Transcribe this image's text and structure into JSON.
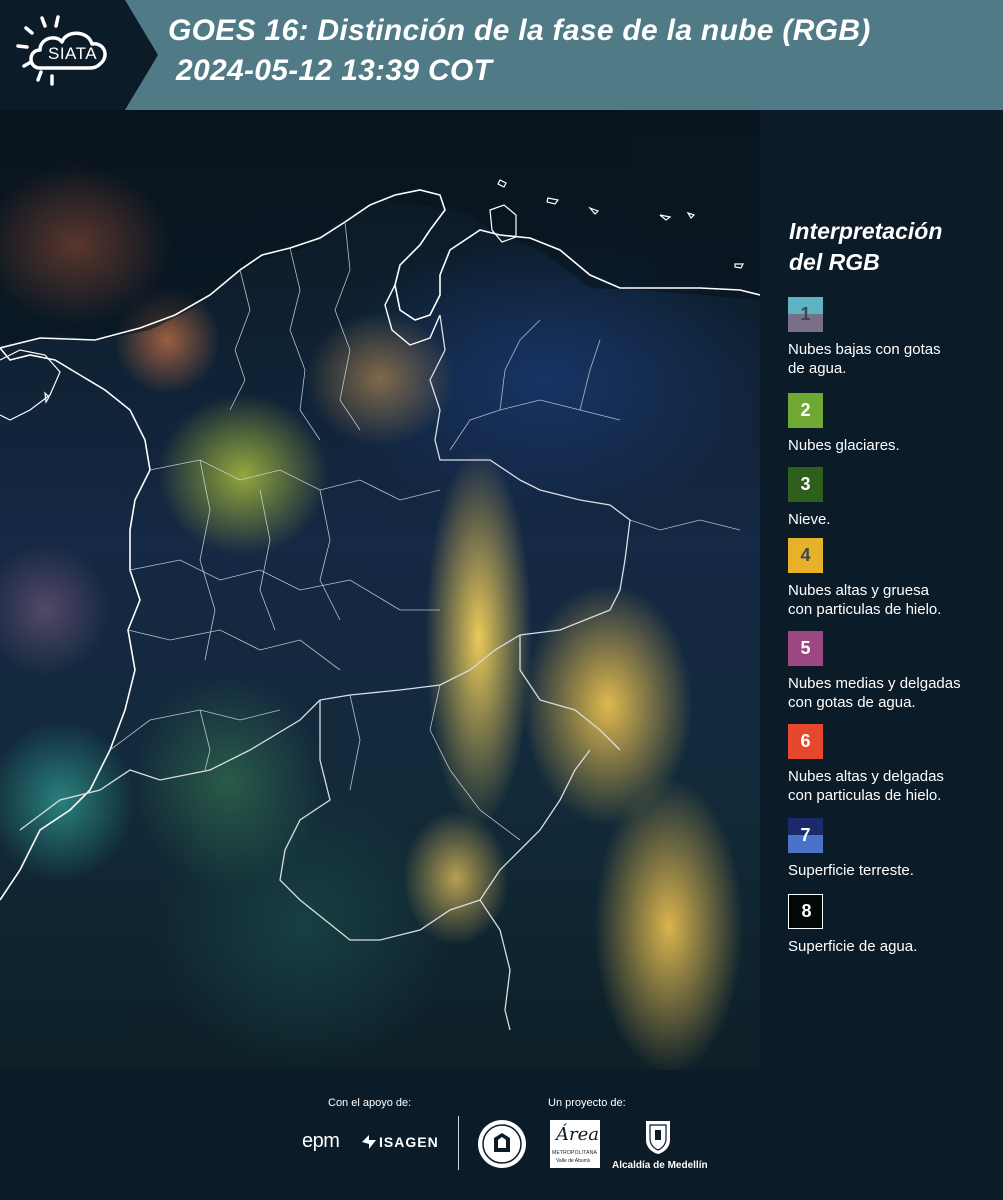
{
  "header": {
    "logo_text": "SIATA",
    "title": "GOES 16: Distinción de la fase de la nube (RGB)",
    "subtitle": "2024-05-12 13:39 COT"
  },
  "legend": {
    "title_line1": "Interpretación",
    "title_line2": "del RGB",
    "items": [
      {
        "num": "1",
        "desc_line1": "Nubes bajas con gotas",
        "desc_line2": "de agua.",
        "color_top": "#5fb4c4",
        "color_bottom": "#7a6f89",
        "num_color": "#3d4650"
      },
      {
        "num": "2",
        "desc_line1": "Nubes glaciares.",
        "desc_line2": "",
        "color_top": "#6fa832",
        "color_bottom": "#6fa832",
        "num_color": "#ffffff"
      },
      {
        "num": "3",
        "desc_line1": "Nieve.",
        "desc_line2": "",
        "color_top": "#2f5f1c",
        "color_bottom": "#2f5f1c",
        "num_color": "#ffffff"
      },
      {
        "num": "4",
        "desc_line1": "Nubes altas y gruesa",
        "desc_line2": "con particulas de hielo.",
        "color_top": "#e7b22a",
        "color_bottom": "#e7b22a",
        "num_color": "#3d4650"
      },
      {
        "num": "5",
        "desc_line1": "Nubes medias y delgadas",
        "desc_line2": "con gotas de agua.",
        "color_top": "#9c4782",
        "color_bottom": "#9c4782",
        "num_color": "#ffffff"
      },
      {
        "num": "6",
        "desc_line1": "Nubes altas y delgadas",
        "desc_line2": "con particulas de hielo.",
        "color_top": "#e5482c",
        "color_bottom": "#e5482c",
        "num_color": "#ffffff"
      },
      {
        "num": "7",
        "desc_line1": "Superficie terreste.",
        "desc_line2": "",
        "color_top": "#1a2a6a",
        "color_bottom": "#4a72c8",
        "num_color": "#ffffff"
      },
      {
        "num": "8",
        "desc_line1": "Superficie de agua.",
        "desc_line2": "",
        "color_top": "#020805",
        "color_bottom": "#020805",
        "num_color": "#ffffff"
      }
    ]
  },
  "footer": {
    "support_label": "Con el apoyo de:",
    "project_label": "Un proyecto de:",
    "sponsors": {
      "epm": "epm",
      "isagen": "ISAGEN",
      "area_name": "Área",
      "area_sub1": "METROPOLITANA",
      "area_sub2": "Valle de Aburrá",
      "alcaldia": "Alcaldía de Medellín"
    }
  }
}
